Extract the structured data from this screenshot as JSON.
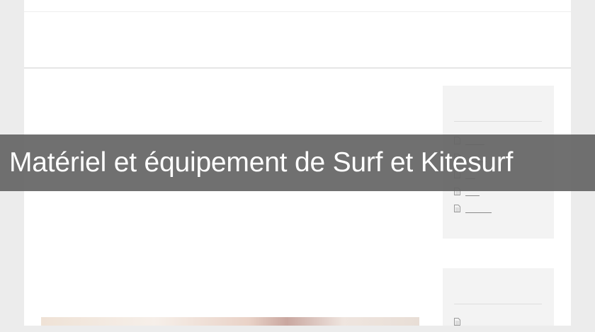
{
  "banner": {
    "title": "Matériel et équipement de Surf et Kitesurf"
  },
  "sidebar": {
    "widgets": [
      {
        "items": [
          {
            "icon": "document-icon"
          },
          {
            "icon": "document-icon"
          },
          {
            "icon": "document-icon"
          },
          {
            "icon": "document-icon"
          },
          {
            "icon": "document-icon"
          }
        ]
      },
      {
        "items": [
          {
            "icon": "document-icon"
          }
        ]
      }
    ]
  },
  "colors": {
    "page_background": "#ececec",
    "content_background": "#ffffff",
    "widget_background": "#f3f3f3",
    "banner_overlay": "#646464",
    "banner_text": "#ffffff"
  }
}
